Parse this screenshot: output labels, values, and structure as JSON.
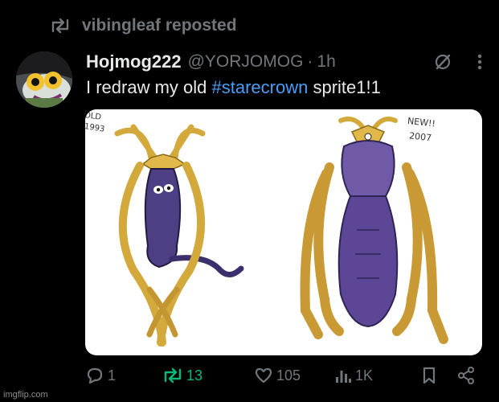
{
  "repost": {
    "icon": "repost-icon",
    "label": "vibingleaf reposted"
  },
  "post": {
    "author_name": "Hojmog222",
    "handle": "@YORJOMOG",
    "separator": "·",
    "time": "1h",
    "text_prefix": "I redraw my old ",
    "hashtag": "#starecrown",
    "text_suffix": " sprite1!1",
    "media": {
      "old_note_line1": "OLD",
      "old_note_line2": "1993",
      "new_note_line1": "NEW!!",
      "new_note_line2": "2007"
    }
  },
  "actions": {
    "replies": "1",
    "reposts": "13",
    "likes": "105",
    "views": "1K"
  },
  "colors": {
    "background": "#000000",
    "text": "#e7e9ea",
    "muted": "#71767b",
    "hashtag": "#4a9df4",
    "reposted": "#00ba7c"
  },
  "watermark": "imgflip.com"
}
